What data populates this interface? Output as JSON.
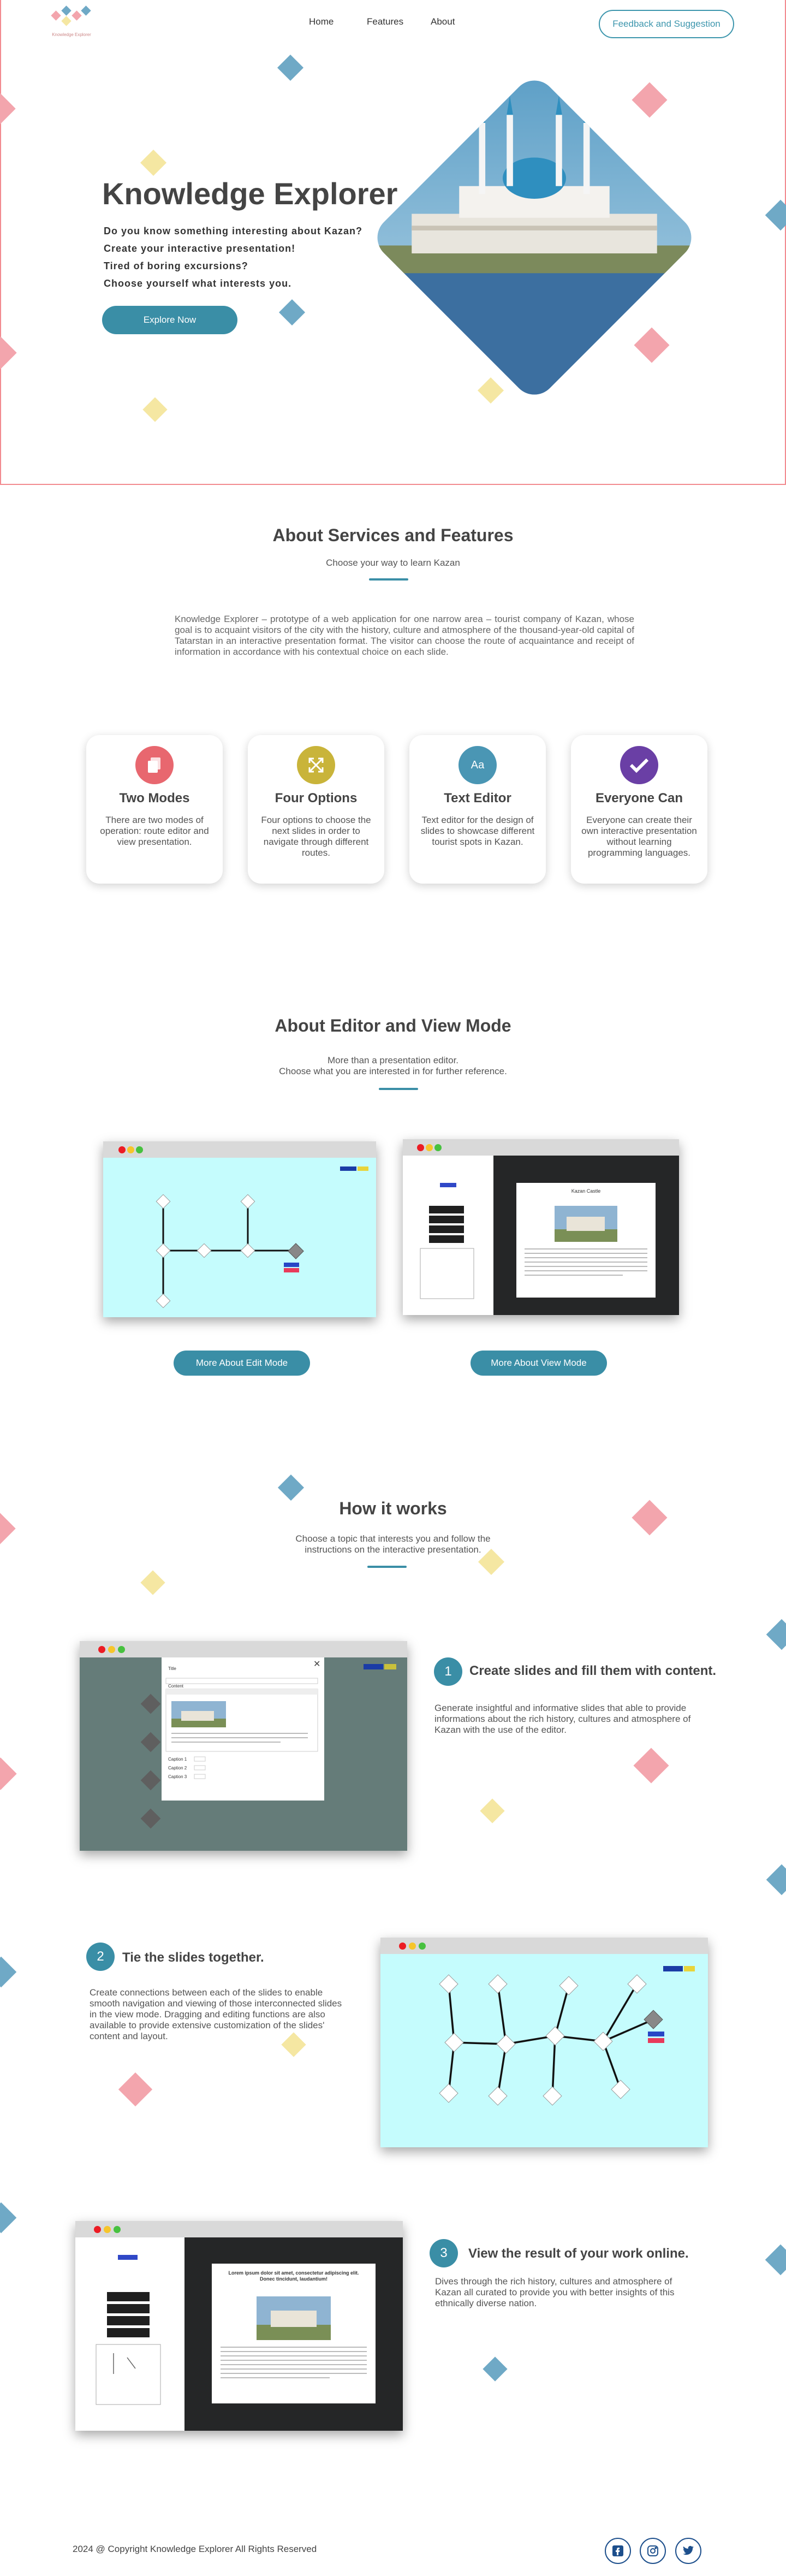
{
  "nav": {
    "logo_text": "Knowledge Explorer",
    "links": [
      "Home",
      "Features",
      "About"
    ],
    "feedback_label": "Feedback and Suggestion"
  },
  "hero": {
    "title": "Knowledge Explorer",
    "lines": [
      "Do you know something interesting about Kazan?",
      "Create your interactive presentation!",
      "Tired of boring excursions?",
      "Choose yourself what interests you."
    ],
    "button_label": "Explore Now"
  },
  "services": {
    "title": "About Services and Features",
    "subtitle": "Choose your way to learn Kazan",
    "description": "Knowledge Explorer – prototype of a web application for one narrow area – tourist company of Kazan, whose goal is to acquaint visitors of the city with the history, culture and atmosphere of the thousand-year-old capital of Tatarstan in an interactive presentation format. The visitor can choose the route of acquaintance and receipt of information in accordance with his contextual choice on each slide.",
    "cards": [
      {
        "title": "Two Modes",
        "text": "There are two modes of operation: route editor and view presentation.",
        "icon": "copy-icon",
        "color": "#e8676f"
      },
      {
        "title": "Four Options",
        "text": "Four options to choose the next slides in order to navigate through different routes.",
        "icon": "crossed-arrows-icon",
        "color": "#c9b43a"
      },
      {
        "title": "Text Editor",
        "text": "Text editor for the design of slides to showcase different tourist spots in Kazan.",
        "icon": "text-aa-icon",
        "color": "#4a96b4",
        "icon_text": "Aa"
      },
      {
        "title": "Everyone Can",
        "text": "Everyone can create their own interactive presentation without learning programming languages.",
        "icon": "checkmark-icon",
        "color": "#6a3fa5"
      }
    ]
  },
  "editor": {
    "title": "About Editor and View Mode",
    "subtitle_lines": [
      "More than a presentation editor.",
      "Choose what you are interested in for further reference."
    ],
    "edit_button": "More About Edit Mode",
    "view_button": "More About View Mode",
    "view_slide_title": "Kazan Castle"
  },
  "how": {
    "title": "How it works",
    "subtitle_lines": [
      "Choose a topic that interests you and follow the",
      "instructions on the interactive presentation."
    ],
    "steps": [
      {
        "num": "1",
        "title": "Create slides and fill them with content.",
        "text": "Generate insightful and informative slides that able to provide informations about the rich history, cultures  and atmosphere of Kazan with the use of the editor."
      },
      {
        "num": "2",
        "title": "Tie the slides together.",
        "text": "Create connections between each of the slides to enable smooth navigation and viewing of those interconnected slides in the view mode. Dragging and editing functions are also available to provide extensive customization of the slides' content and layout."
      },
      {
        "num": "3",
        "title": "View the result of your work online.",
        "text": "Dives through the rich history, cultures and atmosphere of Kazan all curated to provide you with better insights of this ethnically diverse nation."
      }
    ],
    "step1_modal_labels": [
      "Title",
      "Content",
      "Caption 1",
      "Caption 2",
      "Caption 3"
    ],
    "step3_slide_title": "Lorem ipsum dolor sit amet, consectetur adipiscing elit. Donec tincidunt, laudantium!"
  },
  "footer": {
    "copyright": "2024 @ Copyright Knowledge Explorer All Rights Reserved",
    "socials": [
      "facebook-icon",
      "instagram-icon",
      "twitter-icon"
    ]
  },
  "colors": {
    "accent": "#3a8ea6",
    "border": "#f28a8f",
    "canvas": "#c5fcfd"
  }
}
